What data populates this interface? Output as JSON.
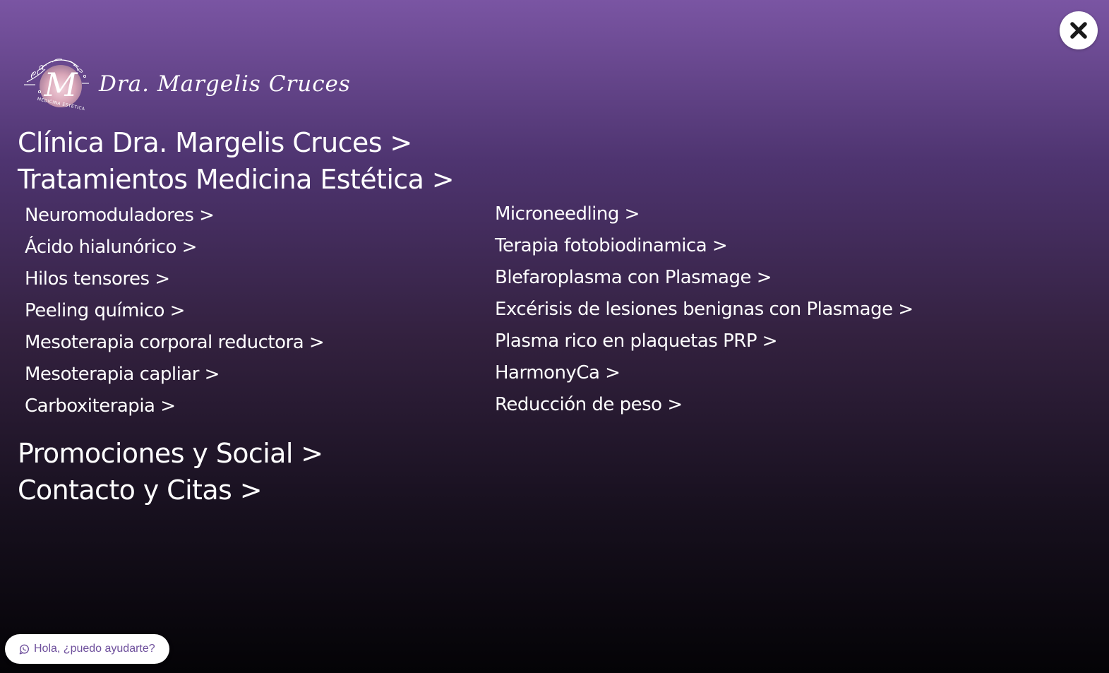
{
  "close": {
    "icon": "close-icon"
  },
  "logo": {
    "name": "Dra. Margelis Cruces",
    "monogram": "M",
    "tagline": "MEDICINA ESTÉTICA",
    "icon": "monogram-logo-icon"
  },
  "menu": {
    "main_items": [
      {
        "label": "Clínica Dra. Margelis Cruces >"
      },
      {
        "label": "Tratamientos Medicina Estética >"
      },
      {
        "label": "Promociones y Social >"
      },
      {
        "label": "Contacto y Citas >"
      }
    ],
    "treatments_left": [
      {
        "label": "Neuromoduladores >"
      },
      {
        "label": "Ácido hialunórico >"
      },
      {
        "label": "Hilos tensores >"
      },
      {
        "label": "Peeling químico >"
      },
      {
        "label": "Mesoterapia corporal reductora >"
      },
      {
        "label": "Mesoterapia capliar >"
      },
      {
        "label": "Carboxiterapia >"
      }
    ],
    "treatments_right": [
      {
        "label": "Microneedling >"
      },
      {
        "label": "Terapia fotobiodinamica >"
      },
      {
        "label": "Blefaroplasma con Plasmage >"
      },
      {
        "label": "Excérisis de lesiones benignas con Plasmage >"
      },
      {
        "label": "Plasma rico en plaquetas PRP >"
      },
      {
        "label": "HarmonyCa >"
      },
      {
        "label": "Reducción de peso >"
      }
    ]
  },
  "chat": {
    "label": "Hola, ¿puedo ayudarte?",
    "icon": "whatsapp-icon"
  },
  "colors": {
    "gradient_top": "#7a55a3",
    "gradient_bottom": "#040306",
    "chat_text": "#6e4f9c",
    "logo_rose": "#d9a6b8"
  }
}
